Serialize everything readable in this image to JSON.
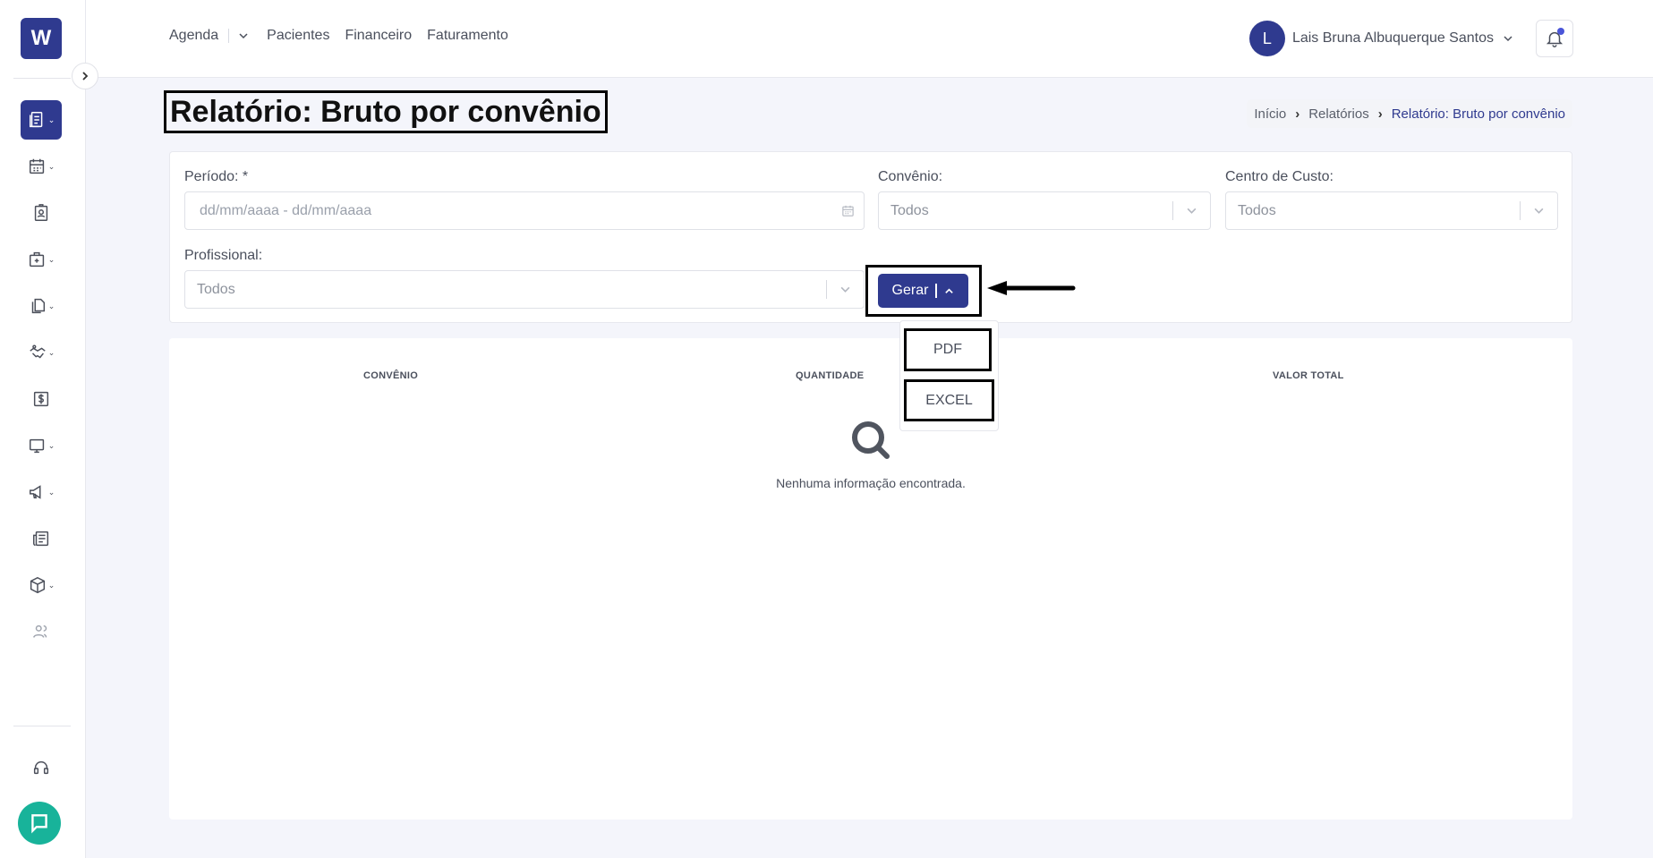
{
  "sidebar": {
    "logo": "W",
    "icons": [
      "reports-icon",
      "calendar-icon",
      "patient-id-icon",
      "medical-kit-icon",
      "documents-icon",
      "handshake-icon",
      "dollar-icon",
      "monitor-icon",
      "megaphone-icon",
      "newspaper-icon",
      "package-icon",
      "users-icon",
      "headset-icon",
      "chat-icon"
    ]
  },
  "header": {
    "nav": {
      "agenda": "Agenda",
      "pacientes": "Pacientes",
      "financeiro": "Financeiro",
      "faturamento": "Faturamento"
    },
    "user": {
      "initial": "L",
      "name": "Lais Bruna Albuquerque Santos"
    }
  },
  "page": {
    "title": "Relatório: Bruto por convênio",
    "breadcrumb": [
      "Início",
      "Relatórios",
      "Relatório: Bruto por convênio"
    ]
  },
  "filters": {
    "periodo": {
      "label": "Período: *",
      "placeholder": "dd/mm/aaaa - dd/mm/aaaa"
    },
    "convenio": {
      "label": "Convênio:",
      "value": "Todos"
    },
    "centro_custo": {
      "label": "Centro de Custo:",
      "value": "Todos"
    },
    "profissional": {
      "label": "Profissional:",
      "value": "Todos"
    },
    "gerar_label": "Gerar"
  },
  "dropdown": {
    "items": [
      "PDF",
      "EXCEL"
    ]
  },
  "table": {
    "columns": [
      "CONVÊNIO",
      "QUANTIDADE",
      "VALOR TOTAL"
    ],
    "empty_message": "Nenhuma informação encontrada."
  },
  "colors": {
    "primary": "#2f3a8f",
    "chat": "#18b39a",
    "background": "#f4f5fb"
  }
}
